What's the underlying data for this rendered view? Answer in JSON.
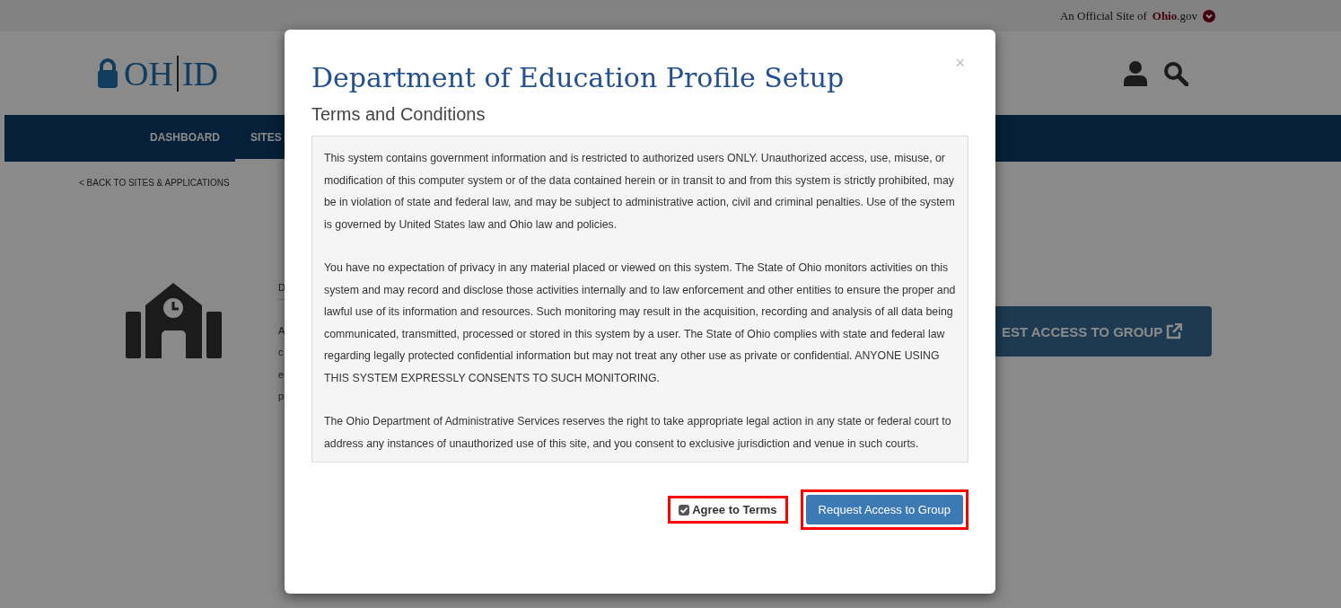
{
  "official_site": {
    "label": "An Official Site of",
    "brand": "**Ohio**.gov"
  },
  "logo": {
    "left": "OH",
    "right": "ID"
  },
  "nav": {
    "items": [
      {
        "label": "DASHBOARD",
        "selected": false
      },
      {
        "label": "SITES",
        "selected": true
      }
    ]
  },
  "back_link": "< BACK TO SITES & APPLICATIONS",
  "covered_text_lines": [
    "D",
    "A",
    "c",
    "e",
    "p"
  ],
  "page_button": {
    "label": "EST ACCESS TO GROUP"
  },
  "modal": {
    "close": "×",
    "title": "Department of Education Profile Setup",
    "subtitle": "Terms and Conditions",
    "paragraphs": [
      "This system contains government information and is restricted to authorized users ONLY. Unauthorized access, use, misuse, or modification of this computer system or of the data contained herein or in transit to and from this system is strictly prohibited, may be in violation of state and federal law, and may be subject to administrative action, civil and criminal penalties. Use of the system is governed by United States law and Ohio law and policies.",
      "You have no expectation of privacy in any material placed or viewed on this system. The State of Ohio monitors activities on this system and may record and disclose those activities internally and to law enforcement and other entities to ensure the proper and lawful use of its information and resources. Such monitoring may result in the acquisition, recording and analysis of all data being communicated, transmitted, processed or stored in this system by a user. The State of Ohio complies with state and federal law regarding legally protected confidential information but may not treat any other use as private or confidential. ANYONE USING THIS SYSTEM EXPRESSLY CONSENTS TO SUCH MONITORING.",
      "The Ohio Department of Administrative Services reserves the right to take appropriate legal action in any state or federal court to address any instances of unauthorized use of this site, and you consent to exclusive jurisdiction and venue in such courts."
    ],
    "agree": {
      "label": "Agree to Terms",
      "checked": true,
      "highlighted": true
    },
    "submit": {
      "label": "Request Access to Group",
      "highlighted": true
    }
  }
}
